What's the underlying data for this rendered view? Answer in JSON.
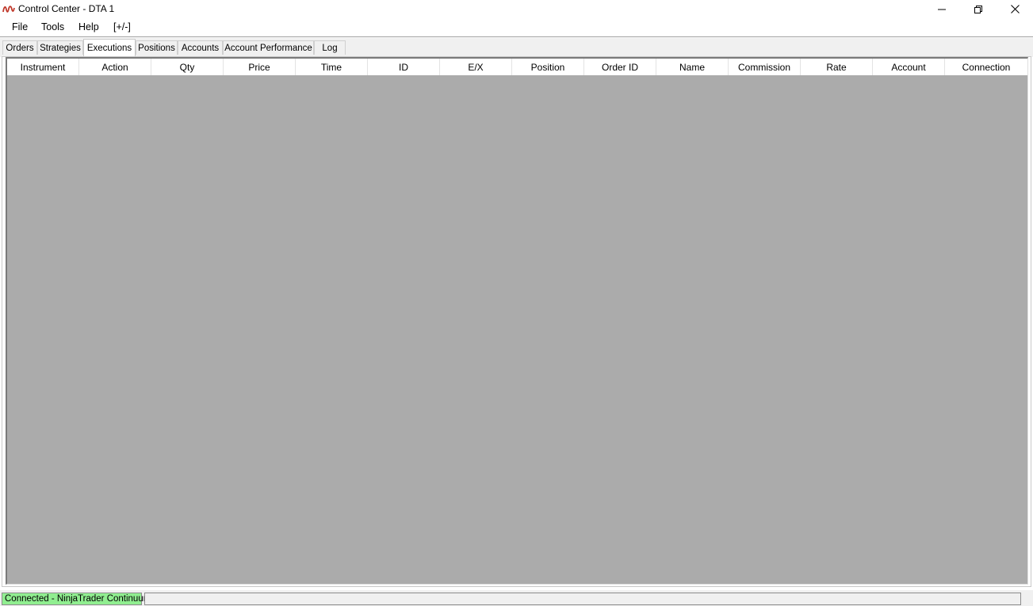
{
  "window": {
    "title": "Control Center - DTA 1",
    "icon": "ninjatrader-logo-icon",
    "controls": [
      "minimize-icon",
      "restore-icon",
      "close-icon"
    ]
  },
  "menu": {
    "file": "File",
    "tools": "Tools",
    "help": "Help",
    "toggle": "[+/-]"
  },
  "tabs": [
    {
      "label": "Orders",
      "active": false
    },
    {
      "label": "Strategies",
      "active": false
    },
    {
      "label": "Executions",
      "active": true
    },
    {
      "label": "Positions",
      "active": false
    },
    {
      "label": "Accounts",
      "active": false
    },
    {
      "label": "Account Performance",
      "active": false
    },
    {
      "label": "Log",
      "active": false
    }
  ],
  "grid": {
    "columns": [
      "Instrument",
      "Action",
      "Qty",
      "Price",
      "Time",
      "ID",
      "E/X",
      "Position",
      "Order ID",
      "Name",
      "Commission",
      "Rate",
      "Account",
      "Connection"
    ],
    "rows": []
  },
  "status": {
    "connection": "Connected - NinjaTrader Continuum",
    "connection_color": "#90ee90",
    "secondary": ""
  }
}
